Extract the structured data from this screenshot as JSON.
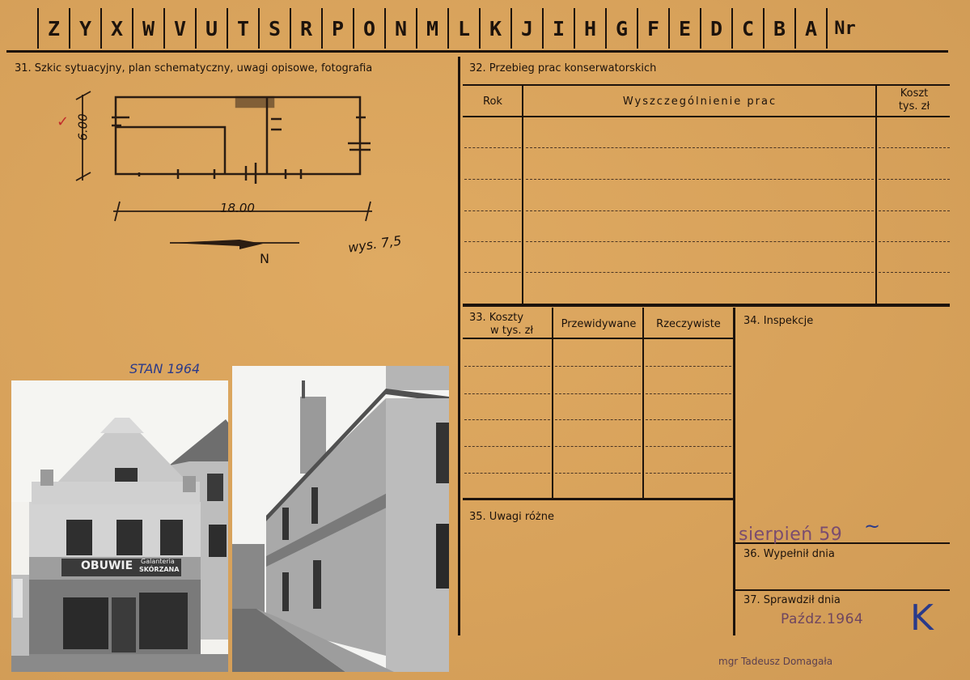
{
  "header": {
    "letters": [
      "Z",
      "Y",
      "X",
      "W",
      "V",
      "U",
      "T",
      "S",
      "R",
      "P",
      "O",
      "N",
      "M",
      "L",
      "K",
      "J",
      "I",
      "H",
      "G",
      "F",
      "E",
      "D",
      "C",
      "B",
      "A"
    ],
    "nr_label": "Nr"
  },
  "section31": {
    "label": "31. Szkic sytuacyjny, plan schematyczny, uwagi opisowe, fotografia"
  },
  "sketch": {
    "dim_vertical": "6.00",
    "dim_horizontal": "18.00",
    "north": "N",
    "height_note": "wys. 7,5",
    "photo_caption": "STAN 1964"
  },
  "photo1": {
    "shop_sign": "OBUWIE",
    "shop_sign_small": "Galanteria",
    "shop_sign_small2": "SKÓRZANA"
  },
  "section32": {
    "label": "32. Przebieg prac konserwatorskich",
    "col_rok": "Rok",
    "col_works": "Wyszczególnienie prac",
    "col_cost_1": "Koszt",
    "col_cost_2": "tys. zł"
  },
  "section33": {
    "label_1": "33. Koszty",
    "label_2": "w tys. zł",
    "col_planned": "Przewidywane",
    "col_actual": "Rzeczywiste"
  },
  "section34": {
    "label": "34. Inspekcje"
  },
  "section35": {
    "label": "35. Uwagi różne"
  },
  "section36": {
    "label": "36. Wypełnił dnia",
    "stamp": "sierpień 59"
  },
  "section37": {
    "label": "37. Sprawdził dnia",
    "stamp_date": "Paźdz.1964",
    "signature_name": "mgr Tadeusz Domagała"
  }
}
